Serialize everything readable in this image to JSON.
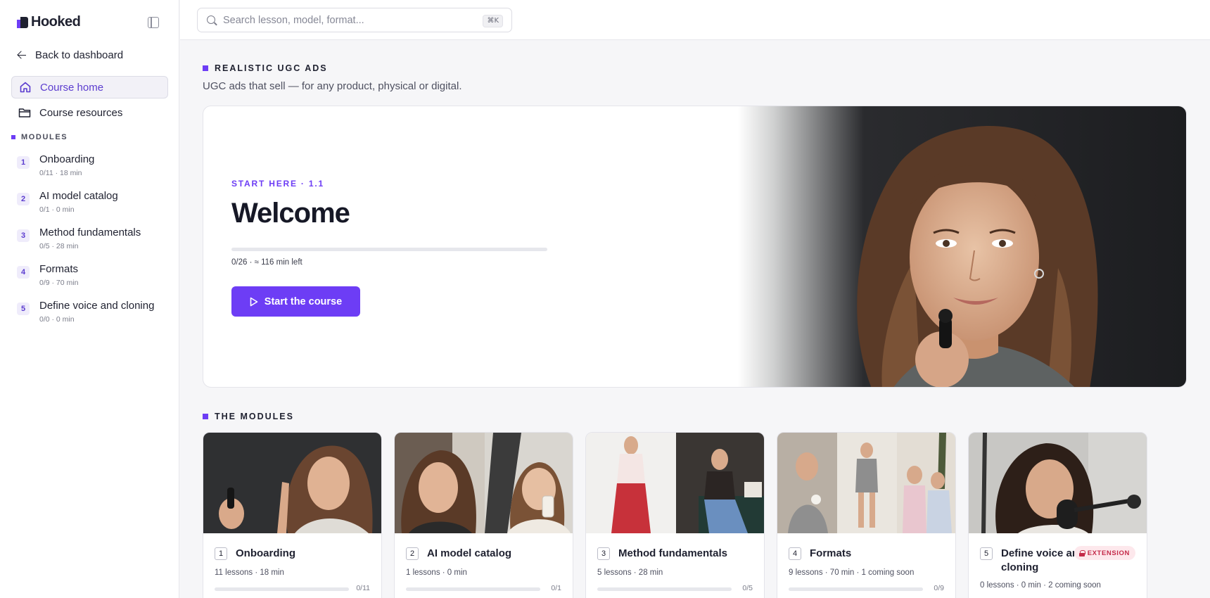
{
  "brand": {
    "name": "Hooked",
    "accent": "#6d3df5"
  },
  "sidebar": {
    "back_label": "Back to dashboard",
    "nav": [
      {
        "label": "Course home",
        "icon": "home-icon",
        "active": true
      },
      {
        "label": "Course resources",
        "icon": "folder-icon",
        "active": false
      }
    ],
    "modules_heading": "MODULES",
    "modules": [
      {
        "num": "1",
        "title": "Onboarding",
        "meta": "0/11 · 18 min"
      },
      {
        "num": "2",
        "title": "AI model catalog",
        "meta": "0/1 · 0 min"
      },
      {
        "num": "3",
        "title": "Method fundamentals",
        "meta": "0/5 · 28 min"
      },
      {
        "num": "4",
        "title": "Formats",
        "meta": "0/9 · 70 min"
      },
      {
        "num": "5",
        "title": "Define voice and cloning",
        "meta": "0/0 · 0 min"
      }
    ]
  },
  "search": {
    "placeholder": "Search lesson, model, format...",
    "value": "",
    "shortcut": "⌘K"
  },
  "course": {
    "label": "REALISTIC UGC ADS",
    "subtitle": "UGC ads that sell — for any product, physical or digital."
  },
  "hero": {
    "eyebrow": "START HERE · 1.1",
    "title": "Welcome",
    "progress_fraction": 0,
    "progress_text": "0/26 · ≈ 116 min left",
    "cta_label": "Start the course"
  },
  "modules_section": {
    "heading": "THE MODULES",
    "cards": [
      {
        "num": "1",
        "title": "Onboarding",
        "meta": "11 lessons · 18 min",
        "count": "0/11",
        "badge": ""
      },
      {
        "num": "2",
        "title": "AI model catalog",
        "meta": "1 lessons · 0 min",
        "count": "0/1",
        "badge": ""
      },
      {
        "num": "3",
        "title": "Method fundamentals",
        "meta": "5 lessons · 28 min",
        "count": "0/5",
        "badge": ""
      },
      {
        "num": "4",
        "title": "Formats",
        "meta": "9 lessons · 70 min · 1 coming soon",
        "count": "0/9",
        "badge": ""
      },
      {
        "num": "5",
        "title": "Define voice and cloning",
        "meta": "0 lessons · 0 min · 2 coming soon",
        "count": "",
        "badge": "EXTENSION"
      }
    ]
  }
}
